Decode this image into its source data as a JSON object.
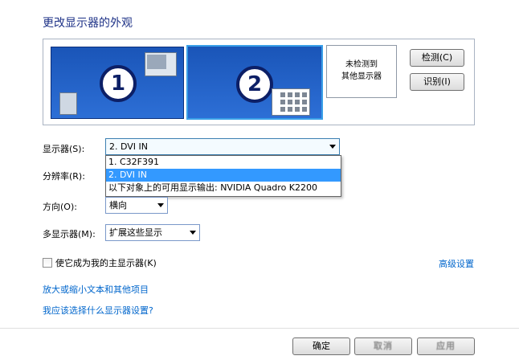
{
  "page": {
    "title": "更改显示器的外观"
  },
  "arrangement": {
    "monitor1": {
      "number": "1"
    },
    "monitor2": {
      "number": "2",
      "selected": true
    },
    "undetected_line1": "未检测到",
    "undetected_line2": "其他显示器",
    "detect_button": "检测(C)",
    "identify_button": "识别(I)"
  },
  "settings": {
    "display_label": "显示器(S):",
    "display_value": "2. DVI IN",
    "display_options": [
      {
        "label": "1. C32F391",
        "selected": false
      },
      {
        "label": "2. DVI IN",
        "selected": true
      },
      {
        "label": "以下对象上的可用显示输出: NVIDIA Quadro K2200",
        "selected": false
      }
    ],
    "resolution_label": "分辨率(R):",
    "orientation_label": "方向(O):",
    "orientation_value": "横向",
    "multi_label": "多显示器(M):",
    "multi_value": "扩展这些显示"
  },
  "main_display_checkbox": {
    "label": "使它成为我的主显示器(K)",
    "checked": false
  },
  "links": {
    "advanced": "高级设置",
    "text_size": "放大或缩小文本和其他项目",
    "which_setting": "我应该选择什么显示器设置?"
  },
  "footer": {
    "ok": "确定",
    "cancel": "取消",
    "apply": "应用"
  },
  "colors": {
    "title": "#1e3287",
    "link": "#0066cc",
    "selection": "#3399ff",
    "monitor": "#2d6fd6"
  },
  "icons": [
    "chevron-down-icon"
  ]
}
